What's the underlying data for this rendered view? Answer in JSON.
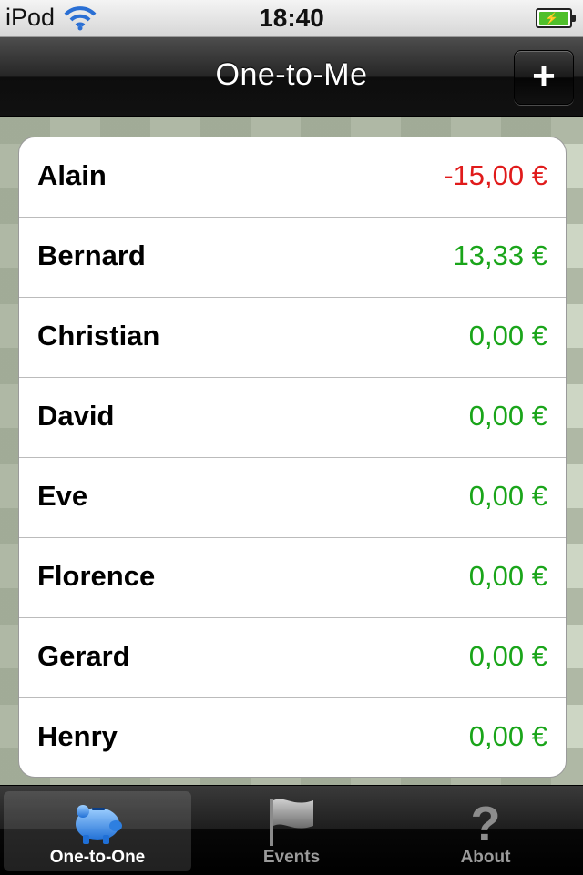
{
  "status_bar": {
    "carrier": "iPod",
    "time": "18:40",
    "battery_icon": "battery-charging-icon",
    "wifi_icon": "wifi-icon"
  },
  "navbar": {
    "title": "One-to-Me",
    "add_button_label": "+"
  },
  "people": [
    {
      "name": "Alain",
      "amount": "-15,00 €",
      "negative": true
    },
    {
      "name": "Bernard",
      "amount": "13,33 €",
      "negative": false
    },
    {
      "name": "Christian",
      "amount": "0,00 €",
      "negative": false
    },
    {
      "name": "David",
      "amount": "0,00 €",
      "negative": false
    },
    {
      "name": "Eve",
      "amount": "0,00 €",
      "negative": false
    },
    {
      "name": "Florence",
      "amount": "0,00 €",
      "negative": false
    },
    {
      "name": "Gerard",
      "amount": "0,00 €",
      "negative": false
    },
    {
      "name": "Henry",
      "amount": "0,00 €",
      "negative": false
    }
  ],
  "colors": {
    "positive": "#1aa51a",
    "negative": "#e01b1b"
  },
  "tabs": [
    {
      "label": "One-to-One",
      "icon": "piggy-bank-icon",
      "selected": true
    },
    {
      "label": "Events",
      "icon": "flag-icon",
      "selected": false
    },
    {
      "label": "About",
      "icon": "question-mark-icon",
      "selected": false
    }
  ]
}
